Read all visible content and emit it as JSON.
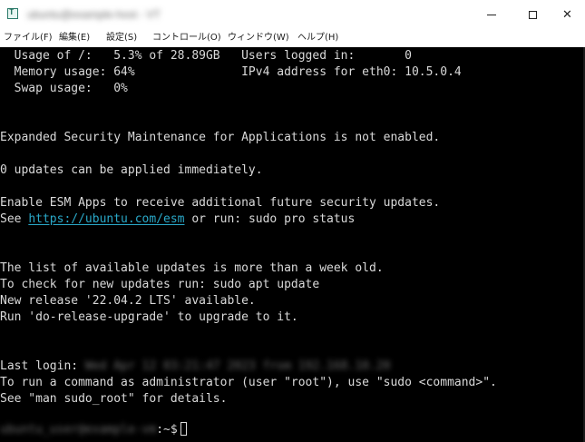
{
  "window": {
    "title": "ubuntu@example-host - VT",
    "minimize_glyph": "—",
    "maximize_glyph": "☐",
    "close_glyph": "✕"
  },
  "menu": [
    {
      "label": "ファイル(F)"
    },
    {
      "label": "編集(E)"
    },
    {
      "label": "設定(S)"
    },
    {
      "label": "コントロール(O)"
    },
    {
      "label": "ウィンドウ(W)"
    },
    {
      "label": "ヘルプ(H)"
    }
  ],
  "terminal": {
    "usage_line": "  Usage of /:   5.3% of 28.89GB   Users logged in:       0",
    "memory_line": "  Memory usage: 64%               IPv4 address for eth0: 10.5.0.4",
    "swap_line": "  Swap usage:   0%",
    "esm_notice": "Expanded Security Maintenance for Applications is not enabled.",
    "updates_line": "0 updates can be applied immediately.",
    "enable_esm": "Enable ESM Apps to receive additional future security updates.",
    "see_prefix": "See ",
    "esm_url": "https://ubuntu.com/esm",
    "see_suffix": " or run: sudo pro status",
    "list_updates": "The list of available updates is more than a week old.",
    "check_updates": "To check for new updates run: sudo apt update",
    "new_release": "New release '22.04.2 LTS' available.",
    "run_upgrade": "Run 'do-release-upgrade' to upgrade to it.",
    "last_login_label": "Last login: ",
    "last_login_value": "Wed Apr 12 03:21:47 2023 from 192.168.10.20",
    "sudo_hint_1": "To run a command as administrator (user \"root\"), use \"sudo <command>\".",
    "sudo_hint_2": "See \"man sudo_root\" for details.",
    "prompt_user": "ubuntu_user@example-vm",
    "prompt_suffix": ":~$"
  }
}
